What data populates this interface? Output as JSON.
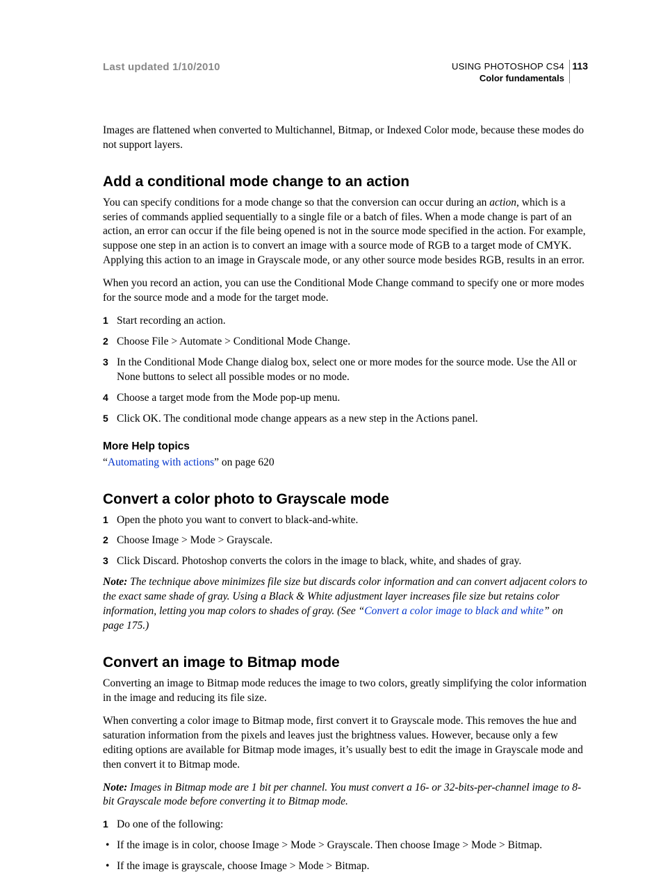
{
  "header": {
    "updated": "Last updated 1/10/2010",
    "doc_title": "USING PHOTOSHOP CS4",
    "chapter": "Color fundamentals",
    "page_number": "113"
  },
  "intro_para": "Images are flattened when converted to Multichannel, Bitmap, or Indexed Color mode, because these modes do not support layers.",
  "s1": {
    "heading": "Add a conditional mode change to an action",
    "p1_a": "You can specify conditions for a mode change so that the conversion can occur during an ",
    "p1_em": "action",
    "p1_b": ", which is a series of commands applied sequentially to a single file or a batch of files. When a mode change is part of an action, an error can occur if the file being opened is not in the source mode specified in the action. For example, suppose one step in an action is to convert an image with a source mode of RGB to a target mode of CMYK. Applying this action to an image in Grayscale mode, or any other source mode besides RGB, results in an error.",
    "p2": "When you record an action, you can use the Conditional Mode Change command to specify one or more modes for the source mode and a mode for the target mode.",
    "steps": [
      "Start recording an action.",
      "Choose File > Automate > Conditional Mode Change.",
      "In the Conditional Mode Change dialog box, select one or more modes for the source mode. Use the All or None buttons to select all possible modes or no mode.",
      "Choose a target mode from the Mode pop-up menu.",
      "Click OK. The conditional mode change appears as a new step in the Actions panel."
    ],
    "more_help_heading": "More Help topics",
    "more_help_prefix": "“",
    "more_help_link": "Automating with actions",
    "more_help_suffix": "” on page 620"
  },
  "s2": {
    "heading": "Convert a color photo to Grayscale mode",
    "steps": [
      "Open the photo you want to convert to black-and-white.",
      "Choose Image > Mode > Grayscale.",
      "Click Discard. Photoshop converts the colors in the image to black, white, and shades of gray."
    ],
    "note_label": "Note:",
    "note_a": " The technique above minimizes file size but discards color information and can convert adjacent colors to the exact same shade of gray. Using a Black & White adjustment layer increases file size but retains color information, letting you map colors to shades of gray. (See “",
    "note_link": "Convert a color image to black and white",
    "note_b": "” on page 175.)"
  },
  "s3": {
    "heading": "Convert an image to Bitmap mode",
    "p1": "Converting an image to Bitmap mode reduces the image to two colors, greatly simplifying the color information in the image and reducing its file size.",
    "p2": "When converting a color image to Bitmap mode, first convert it to Grayscale mode. This removes the hue and saturation information from the pixels and leaves just the brightness values. However, because only a few editing options are available for Bitmap mode images, it’s usually best to edit the image in Grayscale mode and then convert it to Bitmap mode.",
    "note_label": "Note:",
    "note_text": " Images in Bitmap mode are 1 bit per channel. You must convert a 16- or 32-bits-per-channel image to 8-bit Grayscale mode before converting it to Bitmap mode.",
    "steps": [
      "Do one of the following:"
    ],
    "bullets": [
      "If the image is in color, choose Image > Mode > Grayscale. Then choose Image > Mode > Bitmap.",
      "If the image is grayscale, choose Image > Mode > Bitmap."
    ]
  }
}
